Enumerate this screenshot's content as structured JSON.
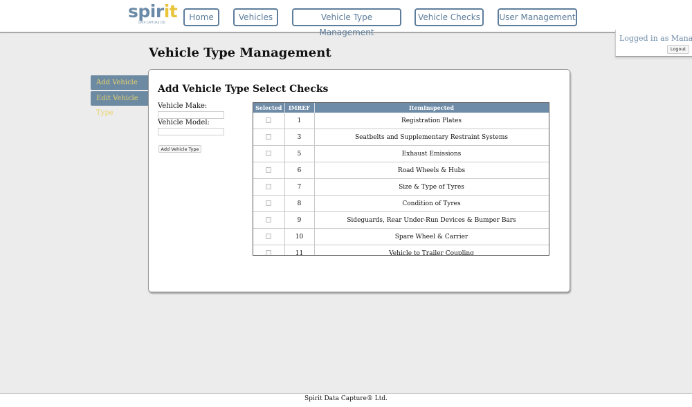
{
  "logo": {
    "main": "spir",
    "accent": "it",
    "sub": "DATA CAPTURE LTD"
  },
  "nav": {
    "home": "Home",
    "vehicles": "Vehicles",
    "vehicle_type_management": "Vehicle Type Management",
    "vehicle_checks": "Vehicle Checks",
    "user_management": "User Management"
  },
  "login": {
    "status": "Logged in as Manager",
    "logout": "Logout"
  },
  "page_title": "Vehicle Type Management",
  "side_tabs": {
    "add": "Add Vehicle Type",
    "edit": "Edit Vehicle Type"
  },
  "form": {
    "heading": "Add Vehicle Type",
    "make_label": "Vehicle Make:",
    "make_value": "",
    "model_label": "Vehicle Model:",
    "model_value": "",
    "submit": "Add Vehicle Type"
  },
  "checks": {
    "heading": "Select Checks",
    "columns": [
      "Selected",
      "IMREF",
      "ItemInspected"
    ],
    "rows": [
      {
        "imref": "1",
        "item": "Registration Plates"
      },
      {
        "imref": "3",
        "item": "Seatbelts and Supplementary Restraint Systems"
      },
      {
        "imref": "5",
        "item": "Exhaust Emissions"
      },
      {
        "imref": "6",
        "item": "Road Wheels & Hubs"
      },
      {
        "imref": "7",
        "item": "Size & Type of Tyres"
      },
      {
        "imref": "8",
        "item": "Condition of Tyres"
      },
      {
        "imref": "9",
        "item": "Sideguards, Rear Under-Run Devices & Bumper Bars"
      },
      {
        "imref": "10",
        "item": "Spare Wheel & Carrier"
      },
      {
        "imref": "11",
        "item": "Vehicle to Trailer Coupling"
      }
    ]
  },
  "footer": "Spirit Data Capture® Ltd.",
  "colors": {
    "accent": "#6e8ca7",
    "nav_border": "#5d7d9b",
    "tab_text": "#e9d46c",
    "logo_dot": "#e8c43a"
  }
}
